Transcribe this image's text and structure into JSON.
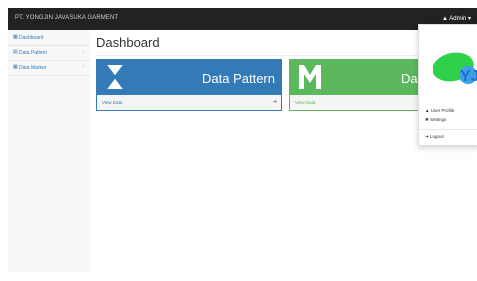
{
  "navbar": {
    "brand": "PT. YONGJIN JAVASUKA GARMENT",
    "user_label": "▲ Admin ▾"
  },
  "sidebar": {
    "items": [
      {
        "label": "Dashboard",
        "icon": "dashboard-icon"
      },
      {
        "label": "Data Pattern",
        "icon": "table-icon"
      },
      {
        "label": "Data Marker",
        "icon": "grid-icon"
      }
    ]
  },
  "main": {
    "title": "Dashboard",
    "panels": [
      {
        "title": "Data Pattern",
        "footer": "View Data",
        "color": "#337ab7"
      },
      {
        "title": "Da",
        "footer": "View Data",
        "color": "#5cb85c"
      }
    ]
  },
  "dropdown": {
    "logo_text": "YJ",
    "items": [
      {
        "label": "User Profile",
        "icon": "user-icon"
      },
      {
        "label": "Settings",
        "icon": "gear-icon"
      },
      {
        "label": "Logout",
        "icon": "logout-icon"
      }
    ]
  }
}
